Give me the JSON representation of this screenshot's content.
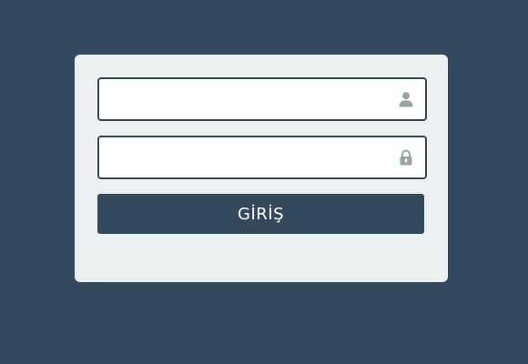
{
  "login_form": {
    "username_field": {
      "value": "",
      "placeholder": "",
      "icon": "user-icon"
    },
    "password_field": {
      "value": "",
      "placeholder": "",
      "icon": "lock-icon"
    },
    "submit_label": "GİRİŞ"
  },
  "colors": {
    "background": "#34495e",
    "card": "#ecf0f1",
    "field_border": "#34495e",
    "icon": "#95a5a6",
    "button": "#34495e",
    "button_text": "#ffffff"
  }
}
